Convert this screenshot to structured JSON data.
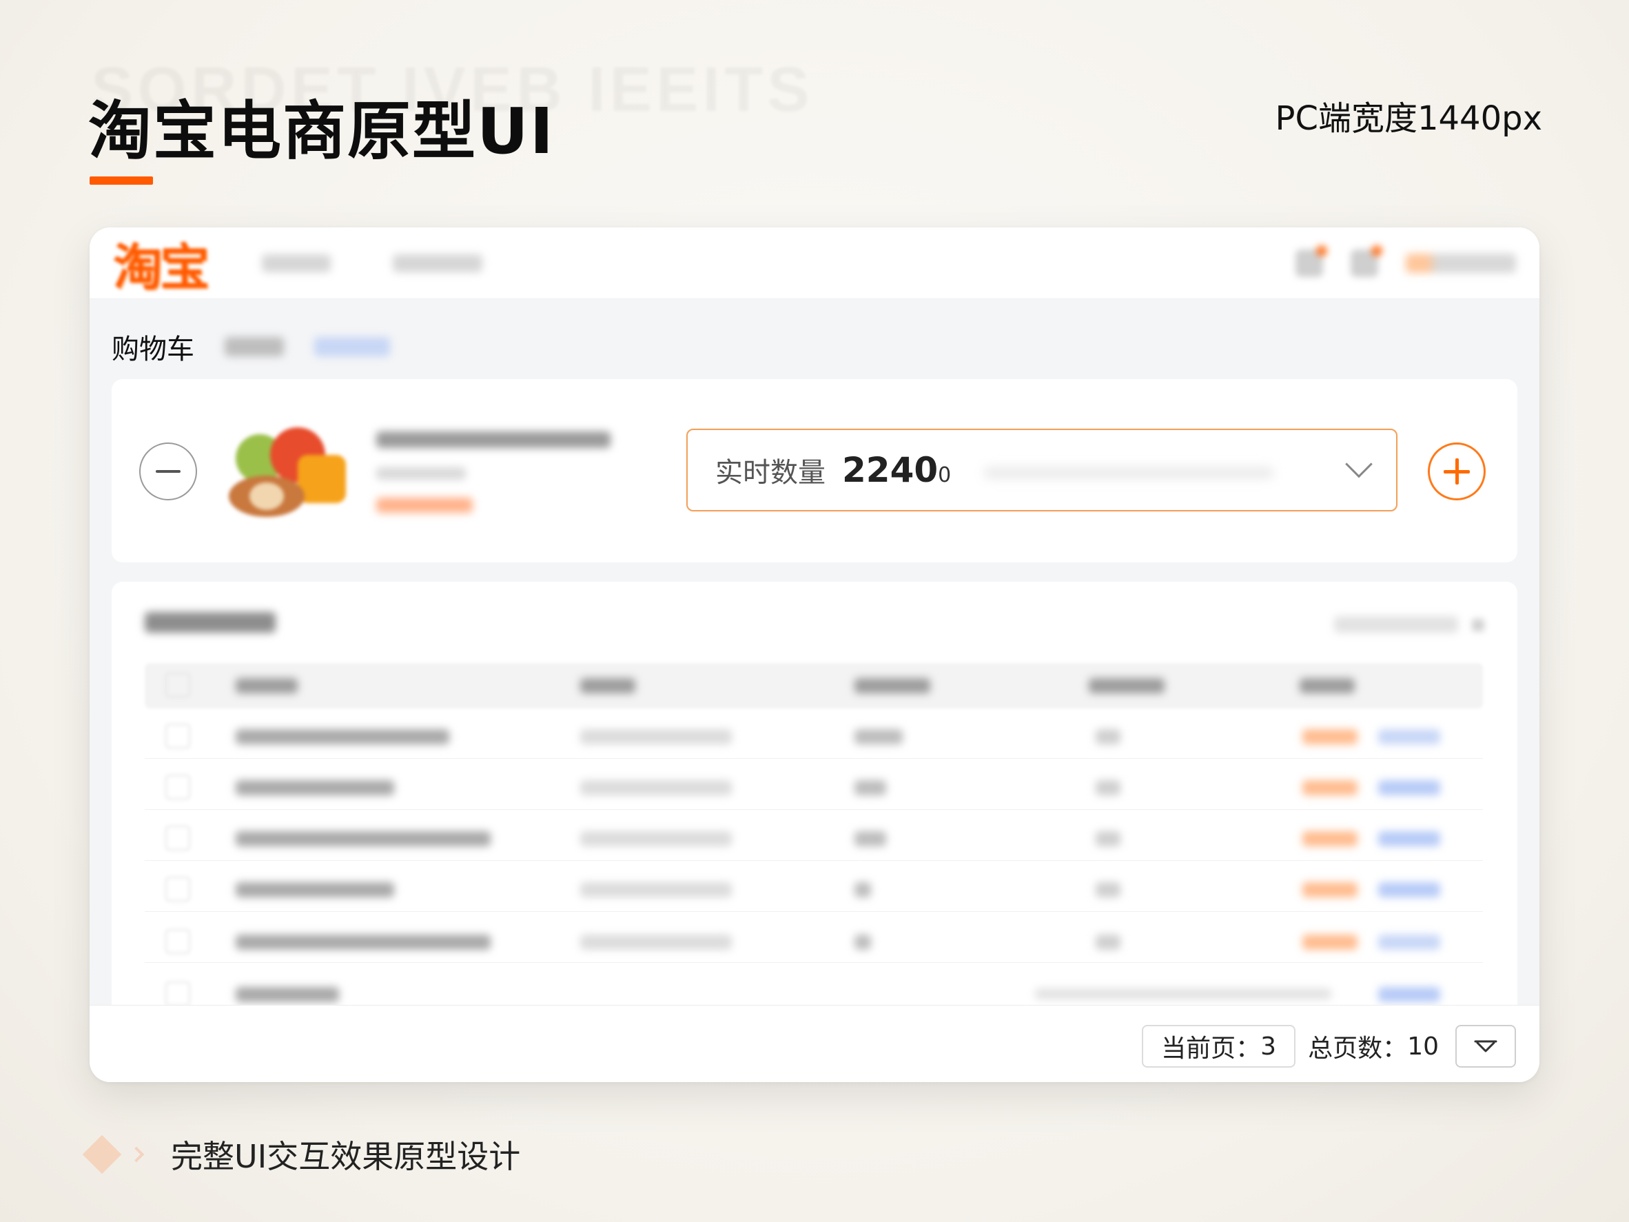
{
  "page": {
    "title": "淘宝电商原型UI",
    "spec": "PC端宽度1440px",
    "caption": "完整UI交互效果原型设计",
    "accent_color": "#ff5a00"
  },
  "navbar": {
    "logo": "淘宝",
    "icons": [
      "bell-icon",
      "message-icon"
    ]
  },
  "breadcrumb": {
    "active": "购物车"
  },
  "product": {
    "quantity_label": "实时数量",
    "quantity_value": "2240",
    "quantity_suffix": "0"
  },
  "pagination": {
    "current_label": "当前页：",
    "current_value": "3",
    "total_label": "总页数：",
    "total_value": "10"
  }
}
